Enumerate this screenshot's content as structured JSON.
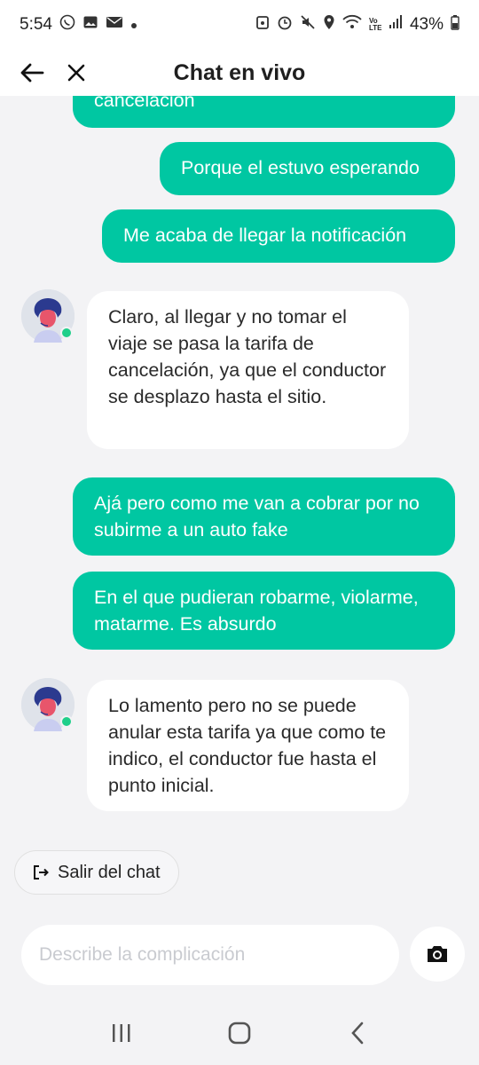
{
  "status_bar": {
    "time": "5:54",
    "battery": "43%",
    "network_label": "Vo LTE"
  },
  "header": {
    "title": "Chat en vivo"
  },
  "messages": [
    {
      "type": "sent",
      "text": "cancelación"
    },
    {
      "type": "sent",
      "text": "Porque el estuvo esperando"
    },
    {
      "type": "sent",
      "text": "Me acaba de llegar la notificación"
    },
    {
      "type": "received",
      "text": "Claro, al llegar y no tomar el viaje se pasa la tarifa de cancelación, ya que el conductor se desplazo hasta el sitio."
    },
    {
      "type": "sent",
      "text": "Ajá pero como me van a cobrar por no subirme a un auto fake"
    },
    {
      "type": "sent",
      "text": "En el que pudieran robarme, violarme, matarme.  Es absurdo"
    },
    {
      "type": "received",
      "text": "Lo lamento pero no se puede anular esta tarifa ya que como te indico, el conductor fue hasta el punto inicial."
    }
  ],
  "actions": {
    "exit_label": "Salir del chat"
  },
  "composer": {
    "placeholder": "Describe la complicación"
  },
  "colors": {
    "accent": "#00c7a2",
    "online": "#1fcf8a",
    "background": "#f3f3f5"
  }
}
